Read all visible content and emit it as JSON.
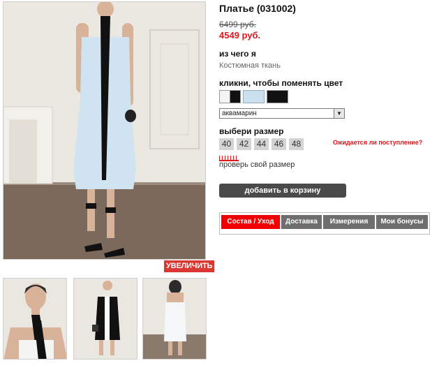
{
  "product": {
    "title": "Платье (031002)",
    "old_price": "6499 руб.",
    "new_price": "4549 руб."
  },
  "material": {
    "label": "из чего я",
    "value": "Костюмная ткань"
  },
  "color": {
    "label": "кликни, чтобы поменять цвет",
    "swatches": [
      "white-black",
      "aquamarine",
      "black"
    ],
    "selected": "аквамарин"
  },
  "size": {
    "label": "выбери размер",
    "options": [
      "40",
      "42",
      "44",
      "46",
      "48"
    ],
    "notify_link": "Ожидается ли поступление?",
    "check_link": "проверь свой размер"
  },
  "gallery": {
    "zoom_label": "УВЕЛИЧИТЬ"
  },
  "cart": {
    "add_label": "добавить в корзину"
  },
  "tabs": [
    "Состав / Уход",
    "Доставка",
    "Измерения",
    "Мои бонусы"
  ],
  "colors": {
    "accent_red": "#e3161b",
    "tab_active": "#f00000",
    "tab_inactive": "#6e6e6e",
    "cart_button": "#4a4a4a",
    "dress_blue": "#cfe3f0"
  }
}
